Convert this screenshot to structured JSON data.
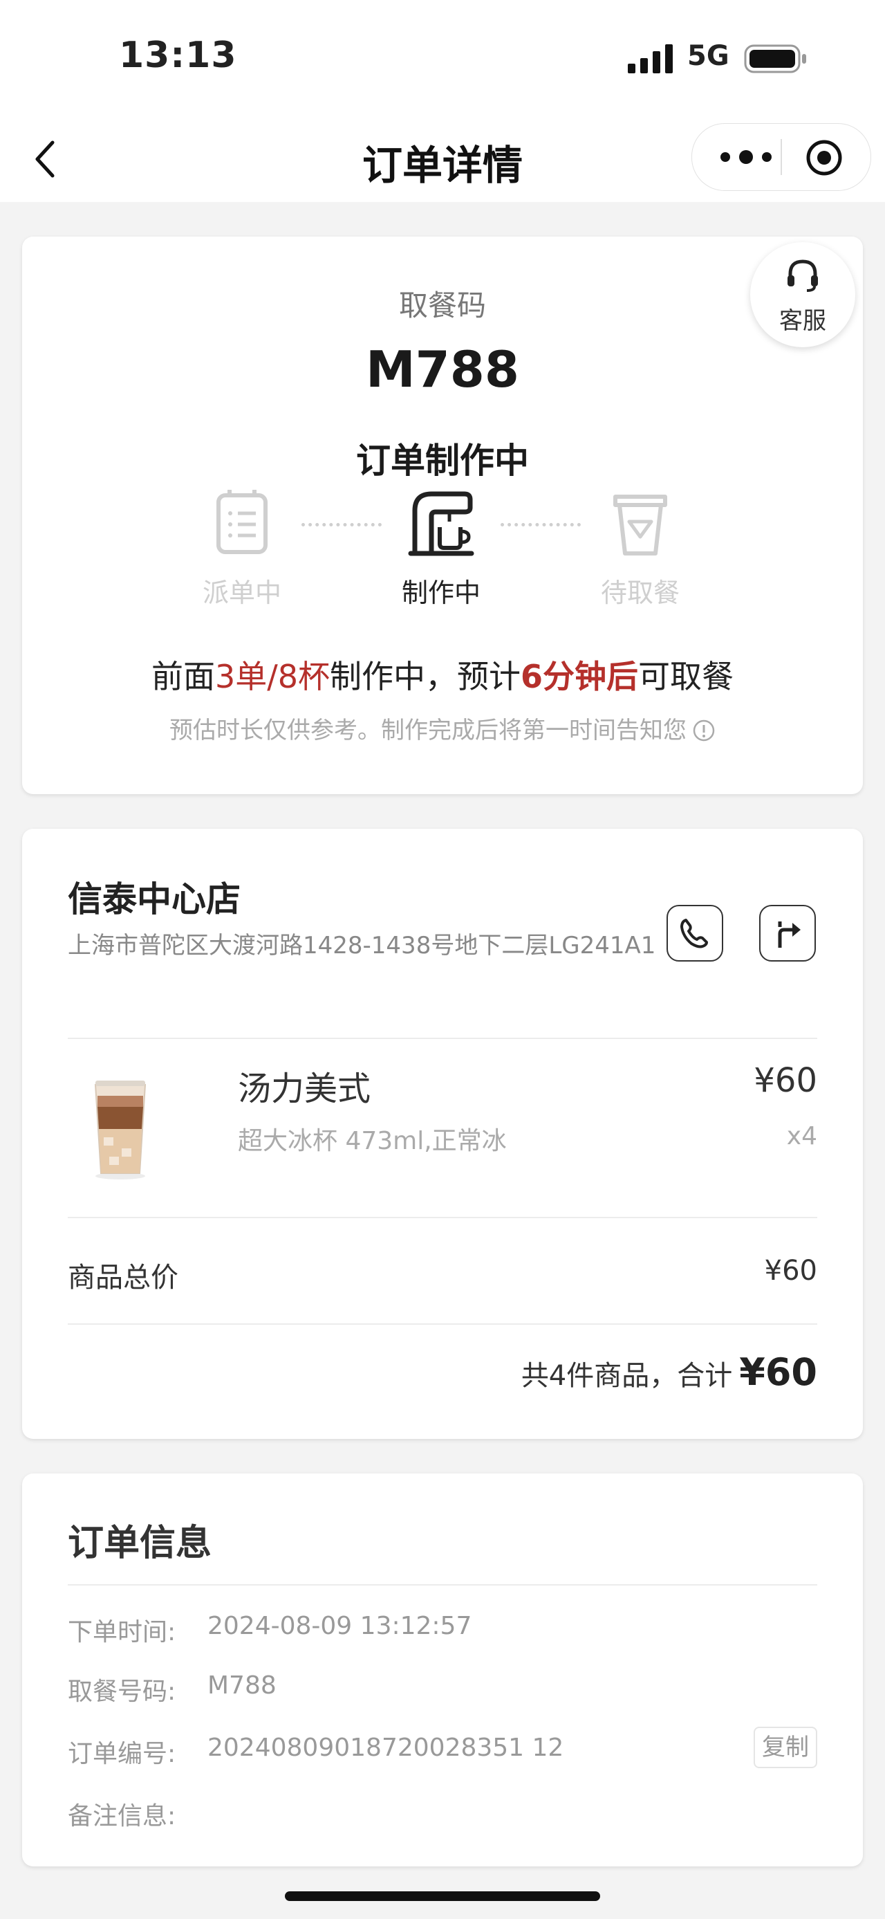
{
  "status_bar": {
    "time": "13:13",
    "network": "5G"
  },
  "nav": {
    "title": "订单详情"
  },
  "pickup": {
    "customer_service_label": "客服",
    "label": "取餐码",
    "code": "M788",
    "status_title": "订单制作中",
    "steps": [
      {
        "label": "派单中",
        "state": "done"
      },
      {
        "label": "制作中",
        "state": "active"
      },
      {
        "label": "待取餐",
        "state": "pending"
      }
    ],
    "queue": {
      "prefix": "前面",
      "orders_cups": "3单/8杯",
      "middle": "制作中，预计",
      "eta": "6分钟后",
      "suffix": "可取餐"
    },
    "estimate_note": "预估时长仅供参考。制作完成后将第一时间告知您"
  },
  "store": {
    "name": "信泰中心店",
    "address": "上海市普陀区大渡河路1428-1438号地下二层LG241A1"
  },
  "items": [
    {
      "name": "汤力美式",
      "spec": "超大冰杯 473ml,正常冰",
      "price": "¥60",
      "qty": "x4"
    }
  ],
  "totals": {
    "subtotal_label": "商品总价",
    "subtotal_value": "¥60",
    "summary_text": "共4件商品，合计",
    "total_amount": "¥60"
  },
  "order_info": {
    "title": "订单信息",
    "rows": [
      {
        "label": "下单时间:",
        "value": "2024-08-09 13:12:57"
      },
      {
        "label": "取餐号码:",
        "value": "M788"
      },
      {
        "label": "订单编号:",
        "value": "20240809018720028351 12"
      },
      {
        "label": "备注信息:",
        "value": ""
      }
    ],
    "copy_label": "复制"
  },
  "colors": {
    "accent_red": "#b5302b",
    "muted_gray": "#cfcfcf"
  }
}
